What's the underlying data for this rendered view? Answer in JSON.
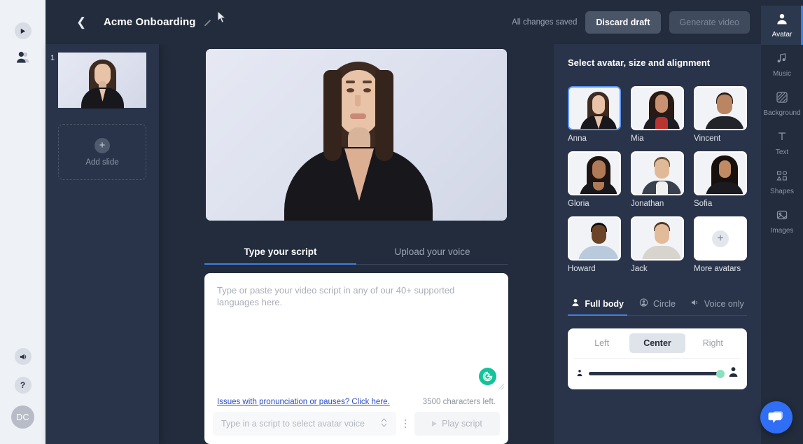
{
  "header": {
    "back_icon": "chevron-left-icon",
    "title": "Acme Onboarding",
    "edit_icon": "pencil-icon",
    "saved_status": "All changes saved",
    "discard_label": "Discard draft",
    "generate_label": "Generate video"
  },
  "left_rail": {
    "top_items": [
      {
        "icon": "play-circle-icon",
        "name": "videos"
      },
      {
        "icon": "users-icon",
        "name": "avatars"
      }
    ],
    "bottom_items": [
      {
        "icon": "megaphone-icon",
        "name": "announcements"
      },
      {
        "icon": "question-mark-icon",
        "name": "help"
      }
    ],
    "user_initials": "DC"
  },
  "slides": {
    "items": [
      {
        "number": "1"
      }
    ],
    "add_label": "Add slide",
    "add_icon": "plus-icon"
  },
  "script": {
    "tabs": [
      {
        "label": "Type your script",
        "active": true
      },
      {
        "label": "Upload your voice",
        "active": false
      }
    ],
    "placeholder": "Type or paste your video script in any of our 40+ supported languages here.",
    "pronunciation_link": "Issues with pronunciation or pauses? Click here.",
    "characters_left": "3500 characters left.",
    "voice_placeholder": "Type in a script to select avatar voice",
    "play_label": "Play script",
    "grammarly_icon": "grammarly-icon",
    "kebab_icon": "more-vertical-icon",
    "resize_icon": "resize-grip-icon"
  },
  "right_panel": {
    "title": "Select avatar, size and alignment",
    "avatars": [
      {
        "name": "Anna",
        "selected": true
      },
      {
        "name": "Mia",
        "selected": false
      },
      {
        "name": "Vincent",
        "selected": false
      },
      {
        "name": "Gloria",
        "selected": false
      },
      {
        "name": "Jonathan",
        "selected": false
      },
      {
        "name": "Sofia",
        "selected": false
      },
      {
        "name": "Howard",
        "selected": false
      },
      {
        "name": "Jack",
        "selected": false
      }
    ],
    "more_avatars_label": "More avatars",
    "more_avatars_icon": "plus-icon",
    "mode_tabs": [
      {
        "label": "Full body",
        "icon": "person-icon",
        "active": true
      },
      {
        "label": "Circle",
        "icon": "circle-person-icon",
        "active": false
      },
      {
        "label": "Voice only",
        "icon": "speaker-icon",
        "active": false
      }
    ],
    "alignment": [
      {
        "label": "Left",
        "active": false
      },
      {
        "label": "Center",
        "active": true
      },
      {
        "label": "Right",
        "active": false
      }
    ],
    "size_slider": {
      "value": 97,
      "min_icon": "person-small-icon",
      "max_icon": "person-large-icon"
    }
  },
  "tool_rail": [
    {
      "label": "Avatar",
      "icon": "person-icon",
      "active": true
    },
    {
      "label": "Music",
      "icon": "music-note-icon",
      "active": false
    },
    {
      "label": "Background",
      "icon": "stripes-icon",
      "active": false
    },
    {
      "label": "Text",
      "icon": "text-t-icon",
      "active": false
    },
    {
      "label": "Shapes",
      "icon": "shapes-icon",
      "active": false
    },
    {
      "label": "Images",
      "icon": "image-icon",
      "active": false
    }
  ],
  "chat": {
    "icon": "chat-bubble-icon"
  },
  "colors": {
    "bg_dark": "#222c3c",
    "panel": "#29344a",
    "accent_blue": "#3f7fe0",
    "slider_green": "#8ce0c0",
    "chat_blue": "#2f6ef5"
  }
}
